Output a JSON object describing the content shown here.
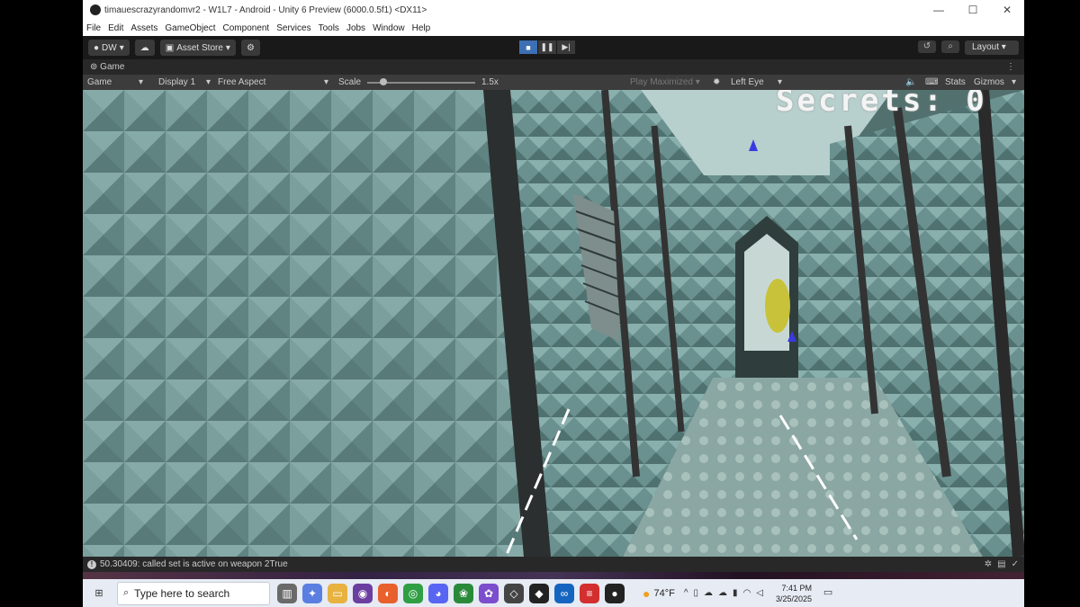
{
  "window": {
    "title": "timauescrazyrandomvr2 - W1L7 - Android - Unity 6 Preview (6000.0.5f1) <DX11>",
    "controls": [
      "—",
      "☐",
      "✕"
    ]
  },
  "menu": [
    "File",
    "Edit",
    "Assets",
    "GameObject",
    "Component",
    "Services",
    "Tools",
    "Jobs",
    "Window",
    "Help"
  ],
  "toolbar": {
    "account": "DW",
    "asset_store": "Asset Store",
    "layout": "Layout"
  },
  "game_tab": {
    "label": "Game"
  },
  "game_bar": {
    "view": "Game",
    "display": "Display 1",
    "aspect": "Free Aspect",
    "scale_label": "Scale",
    "scale_value": "1.5x",
    "scale_fraction": 0.15,
    "play_mode": "Play Maximized",
    "eye": "Left Eye",
    "stats": "Stats",
    "gizmos": "Gizmos"
  },
  "hud": {
    "secrets": "Secrets: 0"
  },
  "status": {
    "message": "50.30409: called set is active on weapon 2True"
  },
  "taskbar": {
    "search_placeholder": "Type here to search",
    "weather": "74°F",
    "time": "7:41 PM",
    "date": "3/25/2025"
  },
  "colors": {
    "play_active": "#3d6fb4",
    "wall": "#6b8f8d",
    "editor_dark": "#1e1e1e"
  }
}
